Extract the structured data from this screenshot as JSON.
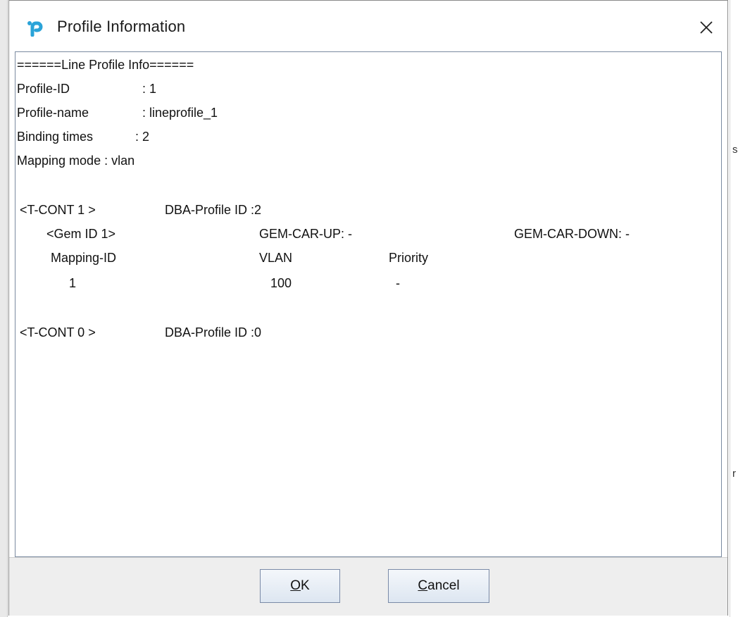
{
  "dialog": {
    "title": "Profile Information",
    "close_glyph": "✕",
    "logo_icon": "tp-link-logo-icon",
    "accent_color": "#2aa3d8"
  },
  "info": {
    "header": "======Line Profile Info======",
    "profile_id_label": "Profile-ID",
    "profile_id_value": ": 1",
    "profile_name_label": "Profile-name",
    "profile_name_value": ": lineprofile_1",
    "binding_times_label": "Binding times",
    "binding_times_value": ": 2",
    "mapping_mode": "Mapping mode : vlan",
    "tcont1": {
      "label": "<T-CONT 1 >",
      "dba": "DBA-Profile ID :2",
      "gem": {
        "label": "<Gem ID 1>",
        "car_up": "GEM-CAR-UP: -",
        "car_down": "GEM-CAR-DOWN: -"
      },
      "columns": [
        "Mapping-ID",
        "VLAN",
        "Priority"
      ],
      "rows": [
        [
          "1",
          "100",
          "-"
        ]
      ]
    },
    "tcont0": {
      "label": "<T-CONT 0 >",
      "dba": "DBA-Profile ID :0"
    }
  },
  "buttons": {
    "ok_mnemonic": "O",
    "ok_rest": "K",
    "cancel_mnemonic": "C",
    "cancel_rest": "ancel"
  },
  "background": {
    "glyph_1": "s",
    "glyph_2": "r"
  }
}
